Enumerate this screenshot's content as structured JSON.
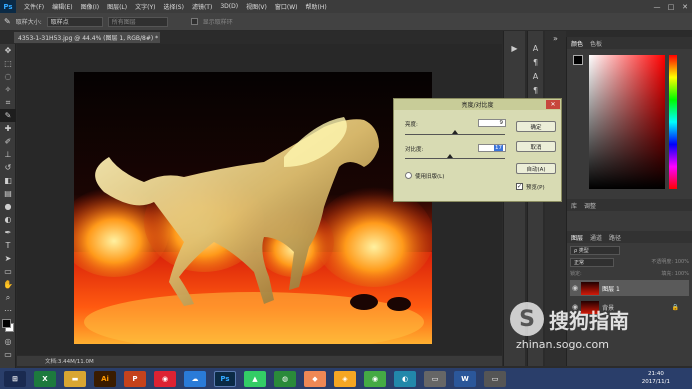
{
  "menubar": {
    "logo": "Ps",
    "items": [
      "文件(F)",
      "编辑(E)",
      "图像(I)",
      "图层(L)",
      "文字(Y)",
      "选择(S)",
      "滤镜(T)",
      "3D(D)",
      "视图(V)",
      "窗口(W)",
      "帮助(H)"
    ],
    "win_min": "—",
    "win_max": "□",
    "win_close": "✕"
  },
  "options": {
    "sample_size_label": "取样大小:",
    "sample_size_value": "取样点",
    "sample_all_value": "所有图层",
    "show_ring_label": "显示取样环"
  },
  "document": {
    "tab_title": "4353-1-31H53.jpg @ 44.4% (图层 1, RGB/8#) *  ✕",
    "status": "文档:3.44M/11.0M"
  },
  "dialog": {
    "title": "亮度/对比度",
    "close": "✕",
    "brightness_label": "亮度:",
    "brightness_value": "9",
    "brightness_level": 0.5,
    "contrast_label": "对比度:",
    "contrast_value": "17",
    "contrast_level": 0.45,
    "legacy_label": "使用旧版(L)",
    "ok_label": "确定",
    "cancel_label": "取消",
    "auto_label": "自动(A)",
    "preview_label": "预览(P)",
    "preview_checked": true
  },
  "panels": {
    "color_tabs": [
      "颜色",
      "色板"
    ],
    "adjust_tabs": [
      "库",
      "调整"
    ],
    "layer_tabs": [
      "图层",
      "通道",
      "路径"
    ],
    "kind_filter": "ρ 类型",
    "blend_mode": "正常",
    "opacity_label": "不透明度: 100%",
    "lock_label": "锁定:",
    "fill_label": "填充: 100%",
    "layers": [
      {
        "name": "图层 1",
        "active": true
      },
      {
        "name": "背景",
        "active": false
      }
    ]
  },
  "watermark": {
    "brand": "搜狗指南",
    "url": "zhinan.sogo.com"
  },
  "taskbar": {
    "time": "21:40",
    "date": "2017/11/1"
  },
  "colors": {
    "ps_blue": "#31a8ff",
    "dialog_bg": "#d8dbb3",
    "taskbar": "#2a3e6a",
    "fire_red": "#c8160a"
  }
}
